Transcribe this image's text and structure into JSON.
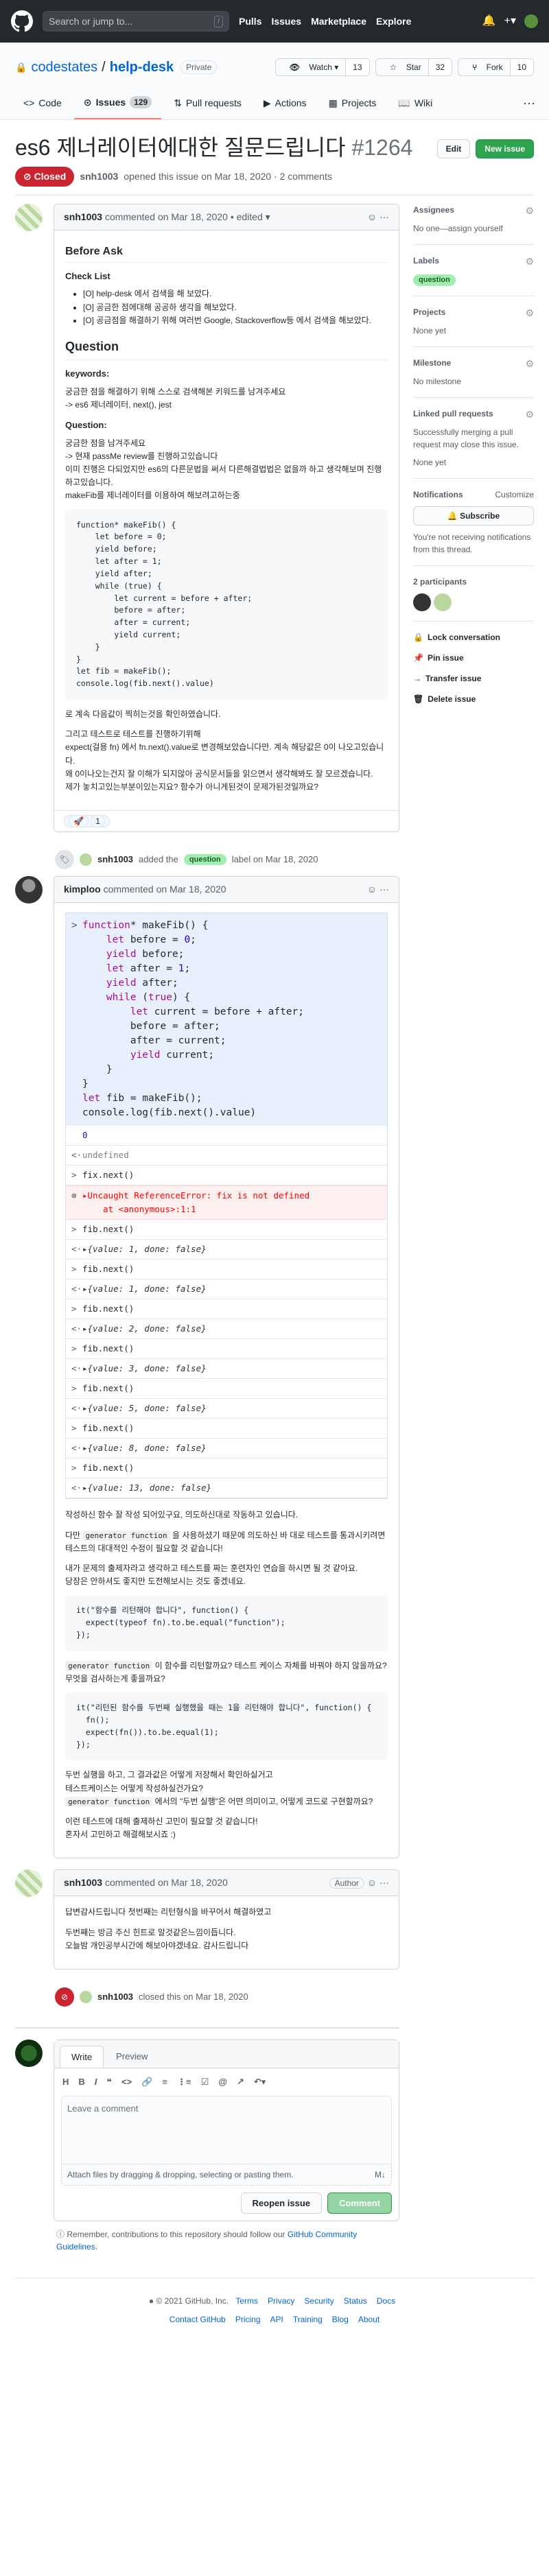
{
  "header": {
    "search_placeholder": "Search or jump to...",
    "search_key": "/",
    "nav": [
      "Pulls",
      "Issues",
      "Marketplace",
      "Explore"
    ],
    "icons": {
      "bell": "bell-icon",
      "plus": "plus-icon"
    }
  },
  "repo": {
    "owner": "codestates",
    "sep": "/",
    "name": "help-desk",
    "visibility": "Private",
    "watch": "Watch",
    "watch_count": "13",
    "star": "Star",
    "star_count": "32",
    "fork": "Fork",
    "fork_count": "10"
  },
  "tabs": [
    {
      "label": "Code"
    },
    {
      "label": "Issues",
      "count": "129"
    },
    {
      "label": "Pull requests"
    },
    {
      "label": "Actions"
    },
    {
      "label": "Projects"
    },
    {
      "label": "Wiki"
    }
  ],
  "issue": {
    "title": "es6 제너레이터에대한 질문드립니다",
    "number": "#1264",
    "edit": "Edit",
    "new_issue": "New issue",
    "state": "Closed",
    "author": "snh1003",
    "meta_text": "opened this issue on Mar 18, 2020 · 2 comments"
  },
  "c1": {
    "author": "snh1003",
    "meta": "commented on Mar 18, 2020 • edited",
    "before_ask": "Before Ask",
    "checklist": "Check List",
    "items": [
      "[O] help-desk 에서 검색을 해 보았다.",
      "[O] 공금한 점에대해 공공하 생각을 해보았다.",
      "[O] 공금점을 해결하기 위해 여러번 Google, Stackoverflow등 에서 검색을 해보았다."
    ],
    "question": "Question",
    "keywords_label": "keywords:",
    "kw_text1": "궁금한 점을 해결하기 위해 스스로 검색해본 키워드를 남겨주세요",
    "kw_text2": "-> es6 제너레이터, next(), jest",
    "q_label": "Question:",
    "q1": "궁금한 점을 남겨주세요",
    "q2": "-> 현재 passMe review를 진행하고있습니다",
    "q3": "이미 진행은 다되었지만 es6의 다른문법을 써서 다른해결법법은 없을까 하고 생각해보며 진행하고있습니다.",
    "q4": "makeFib를 제너레이터를 이용하여 해보려고하는중",
    "code": "function* makeFib() {\n    let before = 0;\n    yield before;\n    let after = 1;\n    yield after;\n    while (true) {\n        let current = before + after;\n        before = after;\n        after = current;\n        yield current;\n    }\n}\nlet fib = makeFib();\nconsole.log(fib.next().value)",
    "p1": "로 계속 다음값이 찍히는것을 확인하였습니다.",
    "p2": "그리고 테스트로 테스트를 진행하기위해",
    "p3": "expect(걸용 fn) 에서 fn.next().value로 변경해보았습니다만. 계속 해당값은 0이 나오고있습니다.",
    "p4": "왜 0이나오는건지 잘 이해가 되지않아 공식문서들을 읽으면서 생각해봐도 잘 모르겠습니다.",
    "p5": "제가 놓치고있는부분이있는지요? 함수가 아니게된것이 문제가된것일까요?",
    "reaction": "🚀",
    "reaction_count": "1"
  },
  "ev1": {
    "actor": "snh1003",
    "pre": "added the",
    "label": "question",
    "post": "label on Mar 18, 2020"
  },
  "c2": {
    "author": "kimploo",
    "meta": "commented on Mar 18, 2020",
    "console": {
      "input": [
        "function* makeFib() {",
        "    let before = 0;",
        "    yield before;",
        "    let after = 1;",
        "    yield after;",
        "    while (true) {",
        "        let current = before + after;",
        "        before = after;",
        "        after = current;",
        "        yield current;",
        "    }",
        "}",
        "let fib = makeFib();",
        "console.log(fib.next().value)"
      ],
      "rows": [
        {
          "g": "",
          "t": "0",
          "c": "blue"
        },
        {
          "g": "<·",
          "t": "undefined",
          "c": "und"
        },
        {
          "g": ">",
          "t": "fix.next()",
          "c": ""
        },
        {
          "g": "⊗",
          "t": "▸Uncaught ReferenceError: fix is not defined\n    at <anonymous>:1:1",
          "c": "err"
        },
        {
          "g": ">",
          "t": "fib.next()",
          "c": ""
        },
        {
          "g": "<·",
          "t": "▸{value: 1, done: false}",
          "c": "objc"
        },
        {
          "g": ">",
          "t": "fib.next()",
          "c": ""
        },
        {
          "g": "<·",
          "t": "▸{value: 1, done: false}",
          "c": "objc"
        },
        {
          "g": ">",
          "t": "fib.next()",
          "c": ""
        },
        {
          "g": "<·",
          "t": "▸{value: 2, done: false}",
          "c": "objc"
        },
        {
          "g": ">",
          "t": "fib.next()",
          "c": ""
        },
        {
          "g": "<·",
          "t": "▸{value: 3, done: false}",
          "c": "objc"
        },
        {
          "g": ">",
          "t": "fib.next()",
          "c": ""
        },
        {
          "g": "<·",
          "t": "▸{value: 5, done: false}",
          "c": "objc"
        },
        {
          "g": ">",
          "t": "fib.next()",
          "c": ""
        },
        {
          "g": "<·",
          "t": "▸{value: 8, done: false}",
          "c": "objc"
        },
        {
          "g": ">",
          "t": "fib.next()",
          "c": ""
        },
        {
          "g": "<·",
          "t": "▸{value: 13, done: false}",
          "c": "objc"
        }
      ]
    },
    "p1": "작성하신 함수 잘 작성 되어있구요, 의도하신대로 작동하고 있습니다.",
    "p2a": "다만",
    "p2code": "generator function",
    "p2b": "을 사용하셨기 때문에 의도하신 바 대로 테스트를 통과시키려면",
    "p3": "테스트의 대대적인 수정이 필요할 것 같습니다!",
    "p4": "내가 문제의 출제자라고 생각하고 테스트를 짜는 훈련자인 연습을 하시면 될 것 같아요.",
    "p5": "당장은 안하셔도 좋지만 도전해보시는 것도 좋겠네요.",
    "code1": "it(\"함수를 리턴해야 합니다\", function() {\n  expect(typeof fn).to.be.equal(\"function\");\n});",
    "p6code": "generator function",
    "p6b": "이 함수를 리턴할까요? 테스트 케이스 자체를 바꿔야 하지 않을까요?",
    "p7": "무엇을 검사하는게 좋을까요?",
    "code2": "it(\"리턴된 함수를 두번째 실행했을 때는 1을 리턴해야 합니다\", function() {\n  fn();\n  expect(fn()).to.be.equal(1);\n});",
    "p8": "두번 실행을 하고, 그 결과값은 어떻게 저장해서 확인하실거고",
    "p9": "테스트케이스는 어떻게 작성하실건가요?",
    "p10code": "generator function",
    "p10b": "에서의 \"두번 실행\"은 어떤 의미이고, 어떻게 코드로 구현할까요?",
    "p11": "이런 테스트에 대해 출제하신 고민이 필요할 것 같습니다!",
    "p12": "혼자서 고민하고 해결해보시죠 :)"
  },
  "c3": {
    "author": "snh1003",
    "meta": "commented on Mar 18, 2020",
    "badge": "Author",
    "p1": "답변감사드립니다 첫번째는 리턴형식을 바꾸어서 해결하였고",
    "p2": "두번째는 방금 주신 힌트로 알것같은느낌이듭니다.",
    "p3": "오늘밤 개인공부시간에 해보아야겠네요. 감사드립니다"
  },
  "ev2": {
    "actor": "snh1003",
    "text": "closed this on Mar 18, 2020"
  },
  "editor": {
    "write": "Write",
    "preview": "Preview",
    "tools": [
      "H",
      "B",
      "I",
      "❝",
      "<>",
      "🔗",
      "≡",
      "⋮≡",
      "☑",
      "@",
      "↗",
      "↶▾"
    ],
    "placeholder": "Leave a comment",
    "attach": "Attach files by dragging & dropping, selecting or pasting them.",
    "reopen": "Reopen issue",
    "comment": "Comment"
  },
  "remind": {
    "text": "Remember, contributions to this repository should follow our",
    "link": "GitHub Community Guidelines",
    "end": "."
  },
  "sidebar": {
    "assignees": "Assignees",
    "assignees_val": "No one—assign yourself",
    "labels": "Labels",
    "label_val": "question",
    "projects": "Projects",
    "projects_val": "None yet",
    "milestone": "Milestone",
    "milestone_val": "No milestone",
    "linked": "Linked pull requests",
    "linked_desc": "Successfully merging a pull request may close this issue.",
    "linked_val": "None yet",
    "notifications": "Notifications",
    "customize": "Customize",
    "subscribe": "Subscribe",
    "notif_desc": "You're not receiving notifications from this thread.",
    "participants": "2 participants",
    "lock": "Lock conversation",
    "pin": "Pin issue",
    "transfer": "Transfer issue",
    "delete": "Delete issue"
  },
  "footer": {
    "copy": "© 2021 GitHub, Inc.",
    "row1": [
      "Terms",
      "Privacy",
      "Security",
      "Status",
      "Docs"
    ],
    "row2": [
      "Contact GitHub",
      "Pricing",
      "API",
      "Training",
      "Blog",
      "About"
    ]
  },
  "colors": {
    "closed": "#cb2431",
    "new_issue": "#2ea44f",
    "label": "#a2eeb0"
  }
}
